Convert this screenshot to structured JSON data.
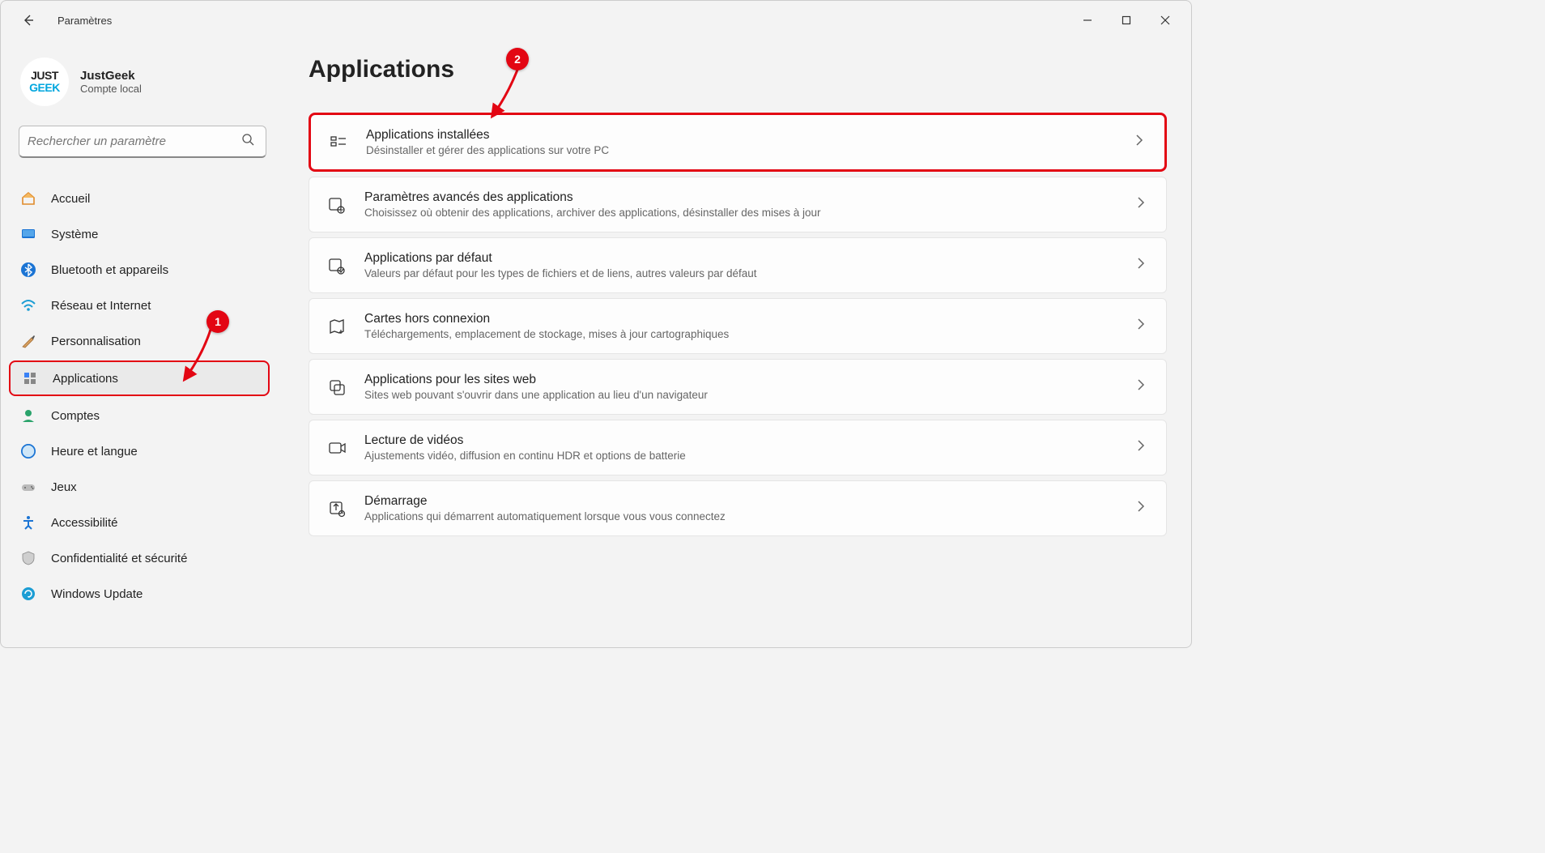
{
  "window": {
    "title": "Paramètres"
  },
  "user": {
    "name": "JustGeek",
    "sub": "Compte local",
    "avatar_line1": "JUST",
    "avatar_line2": "GEEK"
  },
  "search": {
    "placeholder": "Rechercher un paramètre"
  },
  "nav": {
    "items": [
      {
        "label": "Accueil",
        "icon": "home",
        "active": false
      },
      {
        "label": "Système",
        "icon": "system",
        "active": false
      },
      {
        "label": "Bluetooth et appareils",
        "icon": "bluetooth",
        "active": false
      },
      {
        "label": "Réseau et Internet",
        "icon": "network",
        "active": false
      },
      {
        "label": "Personnalisation",
        "icon": "brush",
        "active": false
      },
      {
        "label": "Applications",
        "icon": "apps",
        "active": true,
        "annotated": true
      },
      {
        "label": "Comptes",
        "icon": "accounts",
        "active": false
      },
      {
        "label": "Heure et langue",
        "icon": "time",
        "active": false
      },
      {
        "label": "Jeux",
        "icon": "games",
        "active": false
      },
      {
        "label": "Accessibilité",
        "icon": "accessibility",
        "active": false
      },
      {
        "label": "Confidentialité et sécurité",
        "icon": "privacy",
        "active": false
      },
      {
        "label": "Windows Update",
        "icon": "update",
        "active": false
      }
    ]
  },
  "page": {
    "title": "Applications"
  },
  "cards": [
    {
      "title": "Applications installées",
      "desc": "Désinstaller et gérer des applications sur votre PC",
      "icon": "installed",
      "annotated": true
    },
    {
      "title": "Paramètres avancés des applications",
      "desc": "Choisissez où obtenir des applications, archiver des applications, désinstaller des mises à jour",
      "icon": "advanced"
    },
    {
      "title": "Applications par défaut",
      "desc": "Valeurs par défaut pour les types de fichiers et de liens, autres valeurs par défaut",
      "icon": "default"
    },
    {
      "title": "Cartes hors connexion",
      "desc": "Téléchargements, emplacement de stockage, mises à jour cartographiques",
      "icon": "maps"
    },
    {
      "title": "Applications pour les sites web",
      "desc": "Sites web pouvant s'ouvrir dans une application au lieu d'un navigateur",
      "icon": "sites"
    },
    {
      "title": "Lecture de vidéos",
      "desc": "Ajustements vidéo, diffusion en continu HDR et options de batterie",
      "icon": "video"
    },
    {
      "title": "Démarrage",
      "desc": "Applications qui démarrent automatiquement lorsque vous vous connectez",
      "icon": "startup"
    }
  ],
  "annotations": {
    "badge1": "1",
    "badge2": "2"
  },
  "watermark": {
    "part1": "JUST",
    "part2": "GEEK"
  }
}
